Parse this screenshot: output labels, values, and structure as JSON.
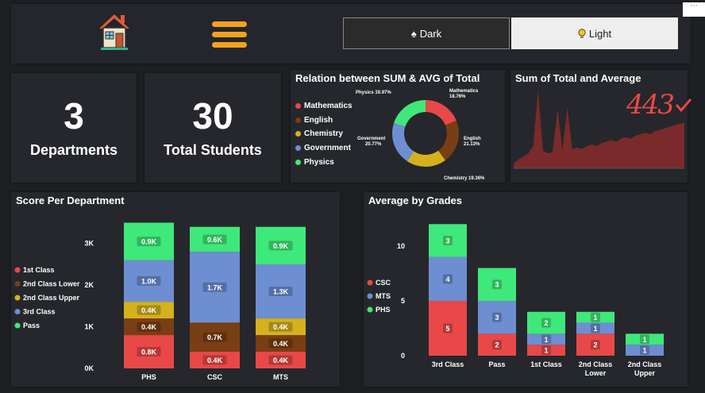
{
  "theme": {
    "dark_label": "Dark",
    "light_label": "Light",
    "dark_icon": "spade-icon",
    "light_icon": "lightbulb-icon"
  },
  "nav": {
    "home_icon": "home-icon",
    "menu_icon": "hamburger-menu-icon"
  },
  "kpis": [
    {
      "value": "3",
      "label": "Departments"
    },
    {
      "value": "30",
      "label": "Total Students"
    }
  ],
  "donut": {
    "title": "Relation between SUM & AVG of Total",
    "legend": [
      {
        "name": "Mathematics",
        "color": "#e84848"
      },
      {
        "name": "English",
        "color": "#7a3e14"
      },
      {
        "name": "Chemistry",
        "color": "#d4b11d"
      },
      {
        "name": "Government",
        "color": "#6e8ed2"
      },
      {
        "name": "Physics",
        "color": "#3fe87a"
      }
    ]
  },
  "area_card": {
    "title": "Sum of Total and Average",
    "big_value": "443"
  },
  "dept_chart": {
    "title": "Score Per Department"
  },
  "grades_chart": {
    "title": "Average by Grades"
  },
  "chart_data": [
    {
      "type": "pie",
      "title": "Relation between SUM & AVG of Total",
      "categories": [
        "Mathematics",
        "English",
        "Chemistry",
        "Government",
        "Physics"
      ],
      "values": [
        18.76,
        21.13,
        19.36,
        20.77,
        19.97
      ],
      "labels": [
        "Mathematics 18.76%",
        "English 21.13%",
        "Chemistry 19.36%",
        "Government 20.77%",
        "Physics 19.97%"
      ],
      "colors": [
        "#e84848",
        "#7a3e14",
        "#d4b11d",
        "#6e8ed2",
        "#3fe87a"
      ]
    },
    {
      "type": "area",
      "title": "Sum of Total and Average",
      "x": [
        1,
        2,
        3,
        4,
        5,
        6,
        7,
        8,
        9,
        10,
        11,
        12,
        13,
        14,
        15,
        16,
        17,
        18,
        19,
        20,
        21,
        22,
        23,
        24,
        25,
        26,
        27,
        28,
        29,
        30,
        31,
        32,
        33,
        34,
        35,
        36
      ],
      "values": [
        6,
        12,
        16,
        20,
        30,
        105,
        24,
        20,
        22,
        80,
        24,
        82,
        26,
        28,
        26,
        30,
        32,
        30,
        34,
        36,
        38,
        36,
        40,
        42,
        40,
        44,
        46,
        48,
        46,
        50,
        52,
        54,
        56,
        58,
        60,
        62
      ],
      "color": "#8a2c2a"
    },
    {
      "type": "bar",
      "stacked": true,
      "title": "Score Per Department",
      "categories": [
        "PHS",
        "CSC",
        "MTS"
      ],
      "yticks": [
        "0K",
        "1K",
        "2K",
        "3K"
      ],
      "ylim": [
        0,
        3700
      ],
      "series": [
        {
          "name": "1st Class",
          "color": "#e84848",
          "values": [
            800,
            400,
            400
          ],
          "labels": [
            "0.8K",
            "0.4K",
            "0.4K"
          ]
        },
        {
          "name": "2nd Class Lower",
          "color": "#7a3e14",
          "values": [
            400,
            700,
            400
          ],
          "labels": [
            "0.4K",
            "0.7K",
            "0.4K"
          ]
        },
        {
          "name": "2nd Class Upper",
          "color": "#d4b11d",
          "values": [
            400,
            0,
            400
          ],
          "labels": [
            "0.4K",
            "",
            "0.4K"
          ]
        },
        {
          "name": "3rd Class",
          "color": "#6e8ed2",
          "values": [
            1000,
            1700,
            1300
          ],
          "labels": [
            "1.0K",
            "1.7K",
            "1.3K"
          ]
        },
        {
          "name": "Pass",
          "color": "#3fe87a",
          "values": [
            900,
            600,
            900
          ],
          "labels": [
            "0.9K",
            "0.6K",
            "0.9K"
          ]
        }
      ]
    },
    {
      "type": "bar",
      "stacked": true,
      "title": "Average by Grades",
      "categories": [
        "3rd Class",
        "Pass",
        "1st Class",
        "2nd Class Lower",
        "2nd Class Upper"
      ],
      "category_lines": [
        [
          "3rd Class"
        ],
        [
          "Pass"
        ],
        [
          "1st Class"
        ],
        [
          "2nd Class",
          "Lower"
        ],
        [
          "2nd Class",
          "Upper"
        ]
      ],
      "yticks": [
        "0",
        "5",
        "10"
      ],
      "ylim": [
        0,
        12.6
      ],
      "series": [
        {
          "name": "CSC",
          "color": "#e84848",
          "values": [
            5,
            2,
            1,
            2,
            0
          ],
          "labels": [
            "5",
            "2",
            "1",
            "2",
            ""
          ]
        },
        {
          "name": "MTS",
          "color": "#6e8ed2",
          "values": [
            4,
            3,
            1,
            1,
            1
          ],
          "labels": [
            "4",
            "3",
            "1",
            "1",
            "1"
          ]
        },
        {
          "name": "PHS",
          "color": "#3fe87a",
          "values": [
            3,
            3,
            2,
            1,
            1
          ],
          "labels": [
            "3",
            "3",
            "2",
            "1",
            "1"
          ]
        }
      ]
    }
  ]
}
